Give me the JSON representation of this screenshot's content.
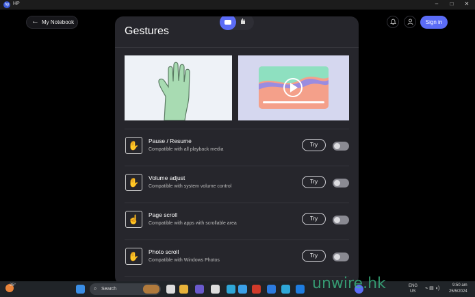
{
  "window": {
    "title": "HP",
    "logo_text": "hp",
    "controls": {
      "minimize": "–",
      "maximize": "□",
      "close": "✕"
    }
  },
  "header": {
    "back_label": "My Notebook",
    "signin_label": "Sign in"
  },
  "panel": {
    "title": "Gestures",
    "mode_selector": {
      "active": "camera",
      "options": [
        "camera-icon",
        "hand-icon"
      ]
    },
    "gestures": [
      {
        "title": "Pause / Resume",
        "subtitle": "Compatible with all playback media",
        "icon": "palm-icon",
        "glyph": "✋",
        "try_label": "Try",
        "enabled": false
      },
      {
        "title": "Volume adjust",
        "subtitle": "Compatible with system volume control",
        "icon": "palm-icon",
        "glyph": "✋",
        "try_label": "Try",
        "enabled": false
      },
      {
        "title": "Page scroll",
        "subtitle": "Compatible with apps with scrollable area",
        "icon": "point-icon",
        "glyph": "☝",
        "try_label": "Try",
        "enabled": false
      },
      {
        "title": "Photo scroll",
        "subtitle": "Compatible with Windows Photos",
        "icon": "swipe-hand-icon",
        "glyph": "✋",
        "try_label": "Try",
        "enabled": false
      }
    ]
  },
  "taskbar": {
    "weather_temp": "25°",
    "search_placeholder": "Search",
    "lang_top": "ENG",
    "lang_bottom": "US",
    "time": "9:50 am",
    "date": "25/5/2024"
  },
  "watermark": "unwire.hk",
  "colors": {
    "accent": "#5b6cf6",
    "panel": "#26262c",
    "background": "#000000"
  }
}
